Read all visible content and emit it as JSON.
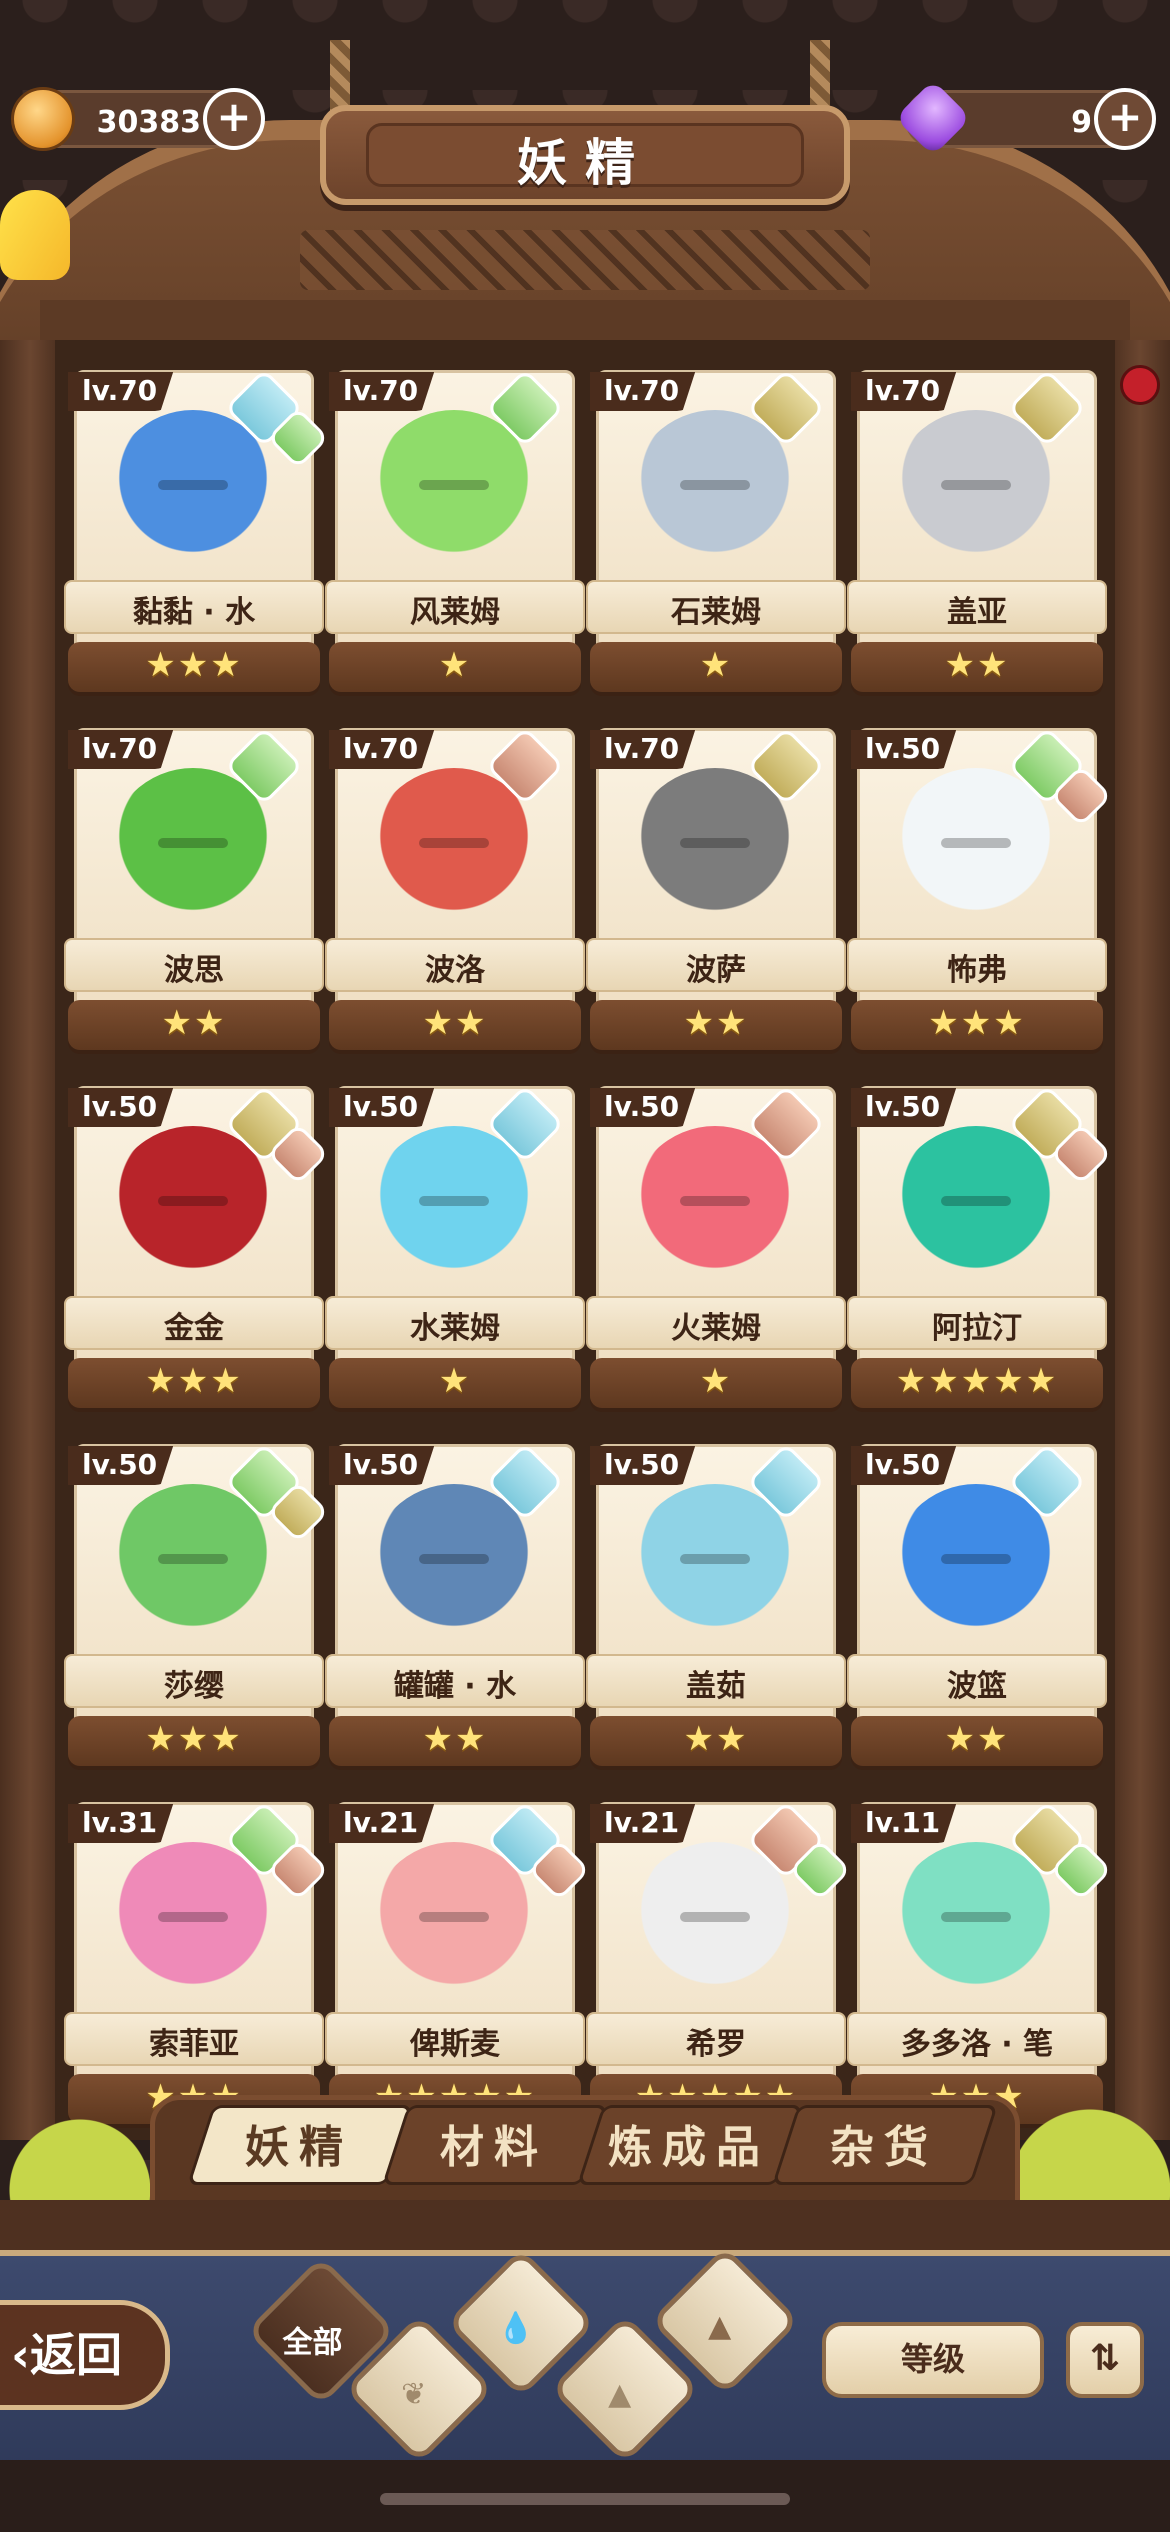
{
  "title": "妖精",
  "resources": {
    "coins": "30383",
    "gems": "9",
    "plus": "+"
  },
  "cards": [
    {
      "level": "lv.70",
      "name": "黏黏 · 水",
      "stars": "★★★",
      "elements": [
        "water",
        "wind"
      ]
    },
    {
      "level": "lv.70",
      "name": "风莱姆",
      "stars": "★",
      "elements": [
        "wind"
      ]
    },
    {
      "level": "lv.70",
      "name": "石莱姆",
      "stars": "★",
      "elements": [
        "earth"
      ]
    },
    {
      "level": "lv.70",
      "name": "盖亚",
      "stars": "★★",
      "elements": [
        "earth"
      ]
    },
    {
      "level": "lv.70",
      "name": "波思",
      "stars": "★★",
      "elements": [
        "wind"
      ]
    },
    {
      "level": "lv.70",
      "name": "波洛",
      "stars": "★★",
      "elements": [
        "fire"
      ]
    },
    {
      "level": "lv.70",
      "name": "波萨",
      "stars": "★★",
      "elements": [
        "earth"
      ]
    },
    {
      "level": "lv.50",
      "name": "怖弗",
      "stars": "★★★",
      "elements": [
        "wind",
        "fire"
      ]
    },
    {
      "level": "lv.50",
      "name": "金金",
      "stars": "★★★",
      "elements": [
        "earth",
        "fire"
      ]
    },
    {
      "level": "lv.50",
      "name": "水莱姆",
      "stars": "★",
      "elements": [
        "water"
      ]
    },
    {
      "level": "lv.50",
      "name": "火莱姆",
      "stars": "★",
      "elements": [
        "fire"
      ]
    },
    {
      "level": "lv.50",
      "name": "阿拉汀",
      "stars": "★★★★★",
      "elements": [
        "earth",
        "fire"
      ]
    },
    {
      "level": "lv.50",
      "name": "莎缨",
      "stars": "★★★",
      "elements": [
        "wind",
        "earth"
      ]
    },
    {
      "level": "lv.50",
      "name": "罐罐 · 水",
      "stars": "★★",
      "elements": [
        "water"
      ]
    },
    {
      "level": "lv.50",
      "name": "盖茹",
      "stars": "★★",
      "elements": [
        "water"
      ]
    },
    {
      "level": "lv.50",
      "name": "波篮",
      "stars": "★★",
      "elements": [
        "water"
      ]
    },
    {
      "level": "lv.31",
      "name": "索菲亚",
      "stars": "★★★",
      "elements": [
        "wind",
        "fire"
      ]
    },
    {
      "level": "lv.21",
      "name": "俾斯麦",
      "stars": "★★★★★",
      "elements": [
        "water",
        "fire"
      ]
    },
    {
      "level": "lv.21",
      "name": "希罗",
      "stars": "★★★★★",
      "elements": [
        "fire",
        "wind"
      ]
    },
    {
      "level": "lv.11",
      "name": "多多洛 · 笔",
      "stars": "★★★",
      "elements": [
        "earth",
        "wind"
      ]
    }
  ],
  "tabs": [
    "妖精",
    "材料",
    "炼成品",
    "杂货"
  ],
  "filters": {
    "all": "全部"
  },
  "back_label": "返回",
  "sort_label": "等级",
  "order_icon": "⇅",
  "colors": {
    "water": "#7cc9dc",
    "wind": "#7fcb66",
    "earth": "#c2ae5c",
    "fire": "#c98a74"
  }
}
